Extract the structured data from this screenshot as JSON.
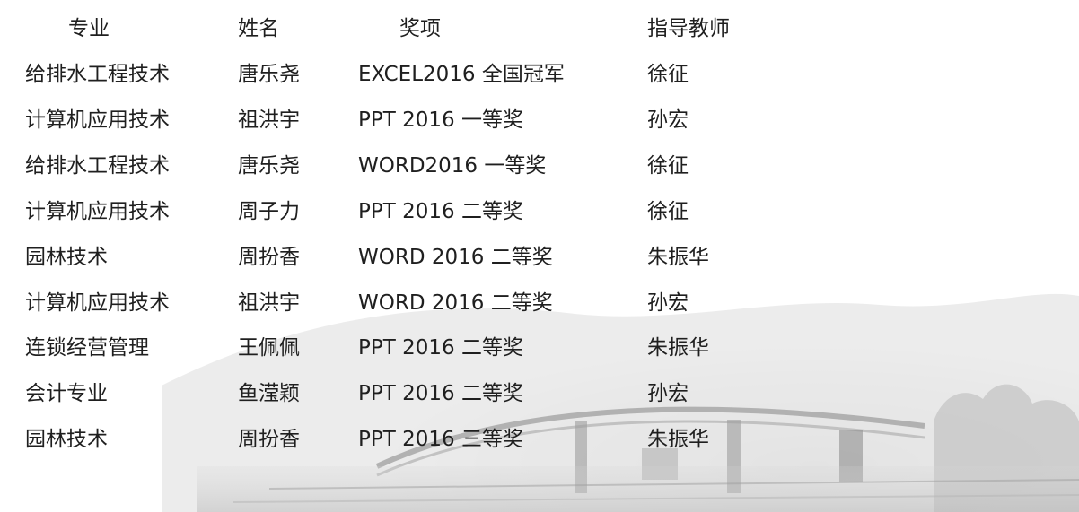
{
  "table": {
    "headers": {
      "major": "专业",
      "name": "姓名",
      "award": "奖项",
      "teacher": "指导教师"
    },
    "rows": [
      {
        "major": "给排水工程技术",
        "name": "唐乐尧",
        "award": "EXCEL2016 全国冠军",
        "teacher": "徐征"
      },
      {
        "major": "计算机应用技术",
        "name": "祖洪宇",
        "award": "PPT 2016 一等奖",
        "teacher": "孙宏"
      },
      {
        "major": "给排水工程技术",
        "name": "唐乐尧",
        "award": "WORD2016 一等奖",
        "teacher": "徐征"
      },
      {
        "major": "计算机应用技术",
        "name": "周子力",
        "award": "PPT 2016 二等奖",
        "teacher": "徐征"
      },
      {
        "major": "园林技术",
        "name": "周扮香",
        "award": "WORD 2016 二等奖",
        "teacher": "朱振华"
      },
      {
        "major": "计算机应用技术",
        "name": "祖洪宇",
        "award": "WORD 2016 二等奖",
        "teacher": "孙宏"
      },
      {
        "major": "连锁经营管理",
        "name": "王佩佩",
        "award": "PPT 2016 二等奖",
        "teacher": "朱振华"
      },
      {
        "major": "会计专业",
        "name": "鱼滢颖",
        "award": "PPT 2016 二等奖",
        "teacher": "孙宏"
      },
      {
        "major": "园林技术",
        "name": "周扮香",
        "award": "PPT 2016 三等奖",
        "teacher": "朱振华"
      }
    ]
  }
}
